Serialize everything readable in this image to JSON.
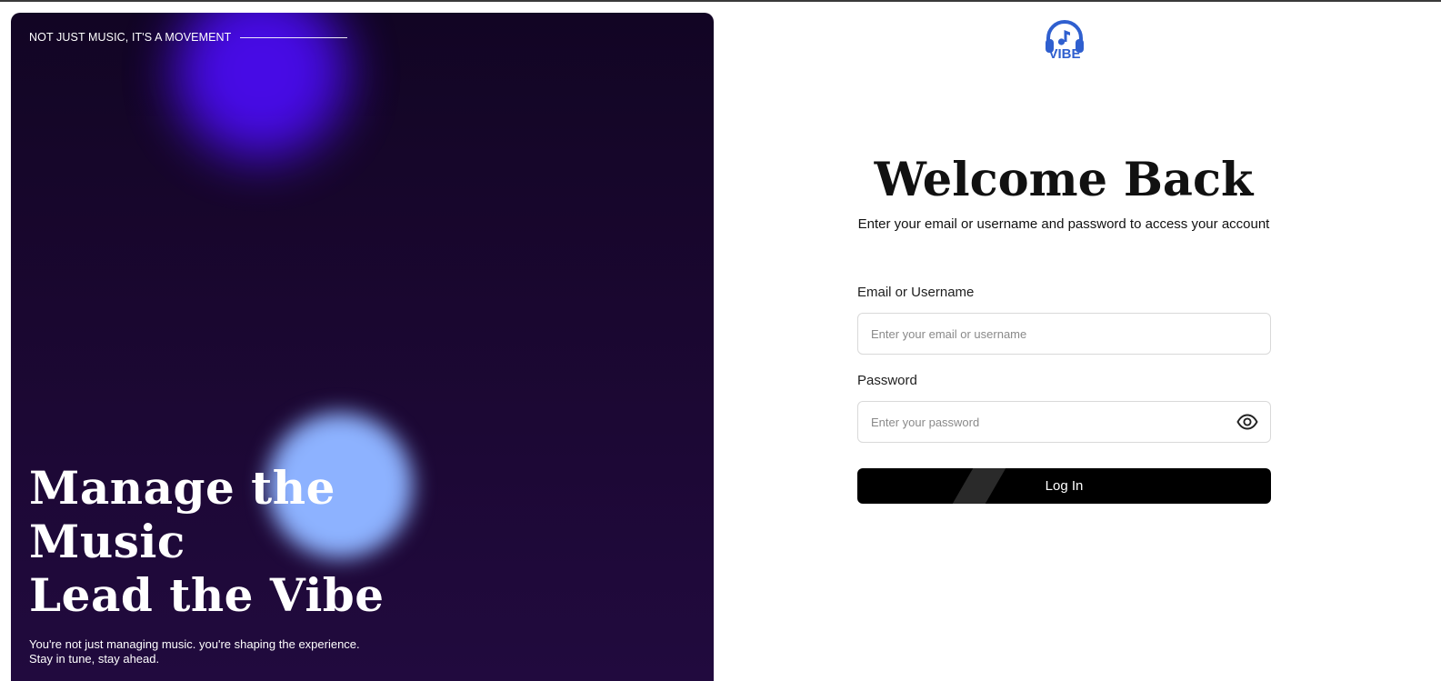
{
  "hero": {
    "tagline": "NOT JUST MUSIC, IT'S A MOVEMENT",
    "headline_lines": [
      "Manage the",
      "Music",
      "Lead the Vibe"
    ],
    "subtext_lines": [
      "You're not just managing music. you're shaping the experience.",
      "Stay in tune, stay ahead."
    ]
  },
  "brand": {
    "logo_text": "VIBE",
    "logo_icon": "headphones-music-note-icon",
    "color": "#2f5fcf"
  },
  "login": {
    "title": "Welcome Back",
    "subtitle": "Enter your email or username and password to access your account",
    "email_label": "Email or Username",
    "email_placeholder": "Enter your email or username",
    "email_value": "",
    "password_label": "Password",
    "password_placeholder": "Enter your password",
    "password_value": "",
    "password_toggle_icon": "eye-icon",
    "submit_label": "Log In"
  },
  "colors": {
    "hero_background": "#1a0730",
    "glow_purple": "#4a0cf0",
    "glow_blue": "#8db2ff",
    "button": "#000000"
  }
}
